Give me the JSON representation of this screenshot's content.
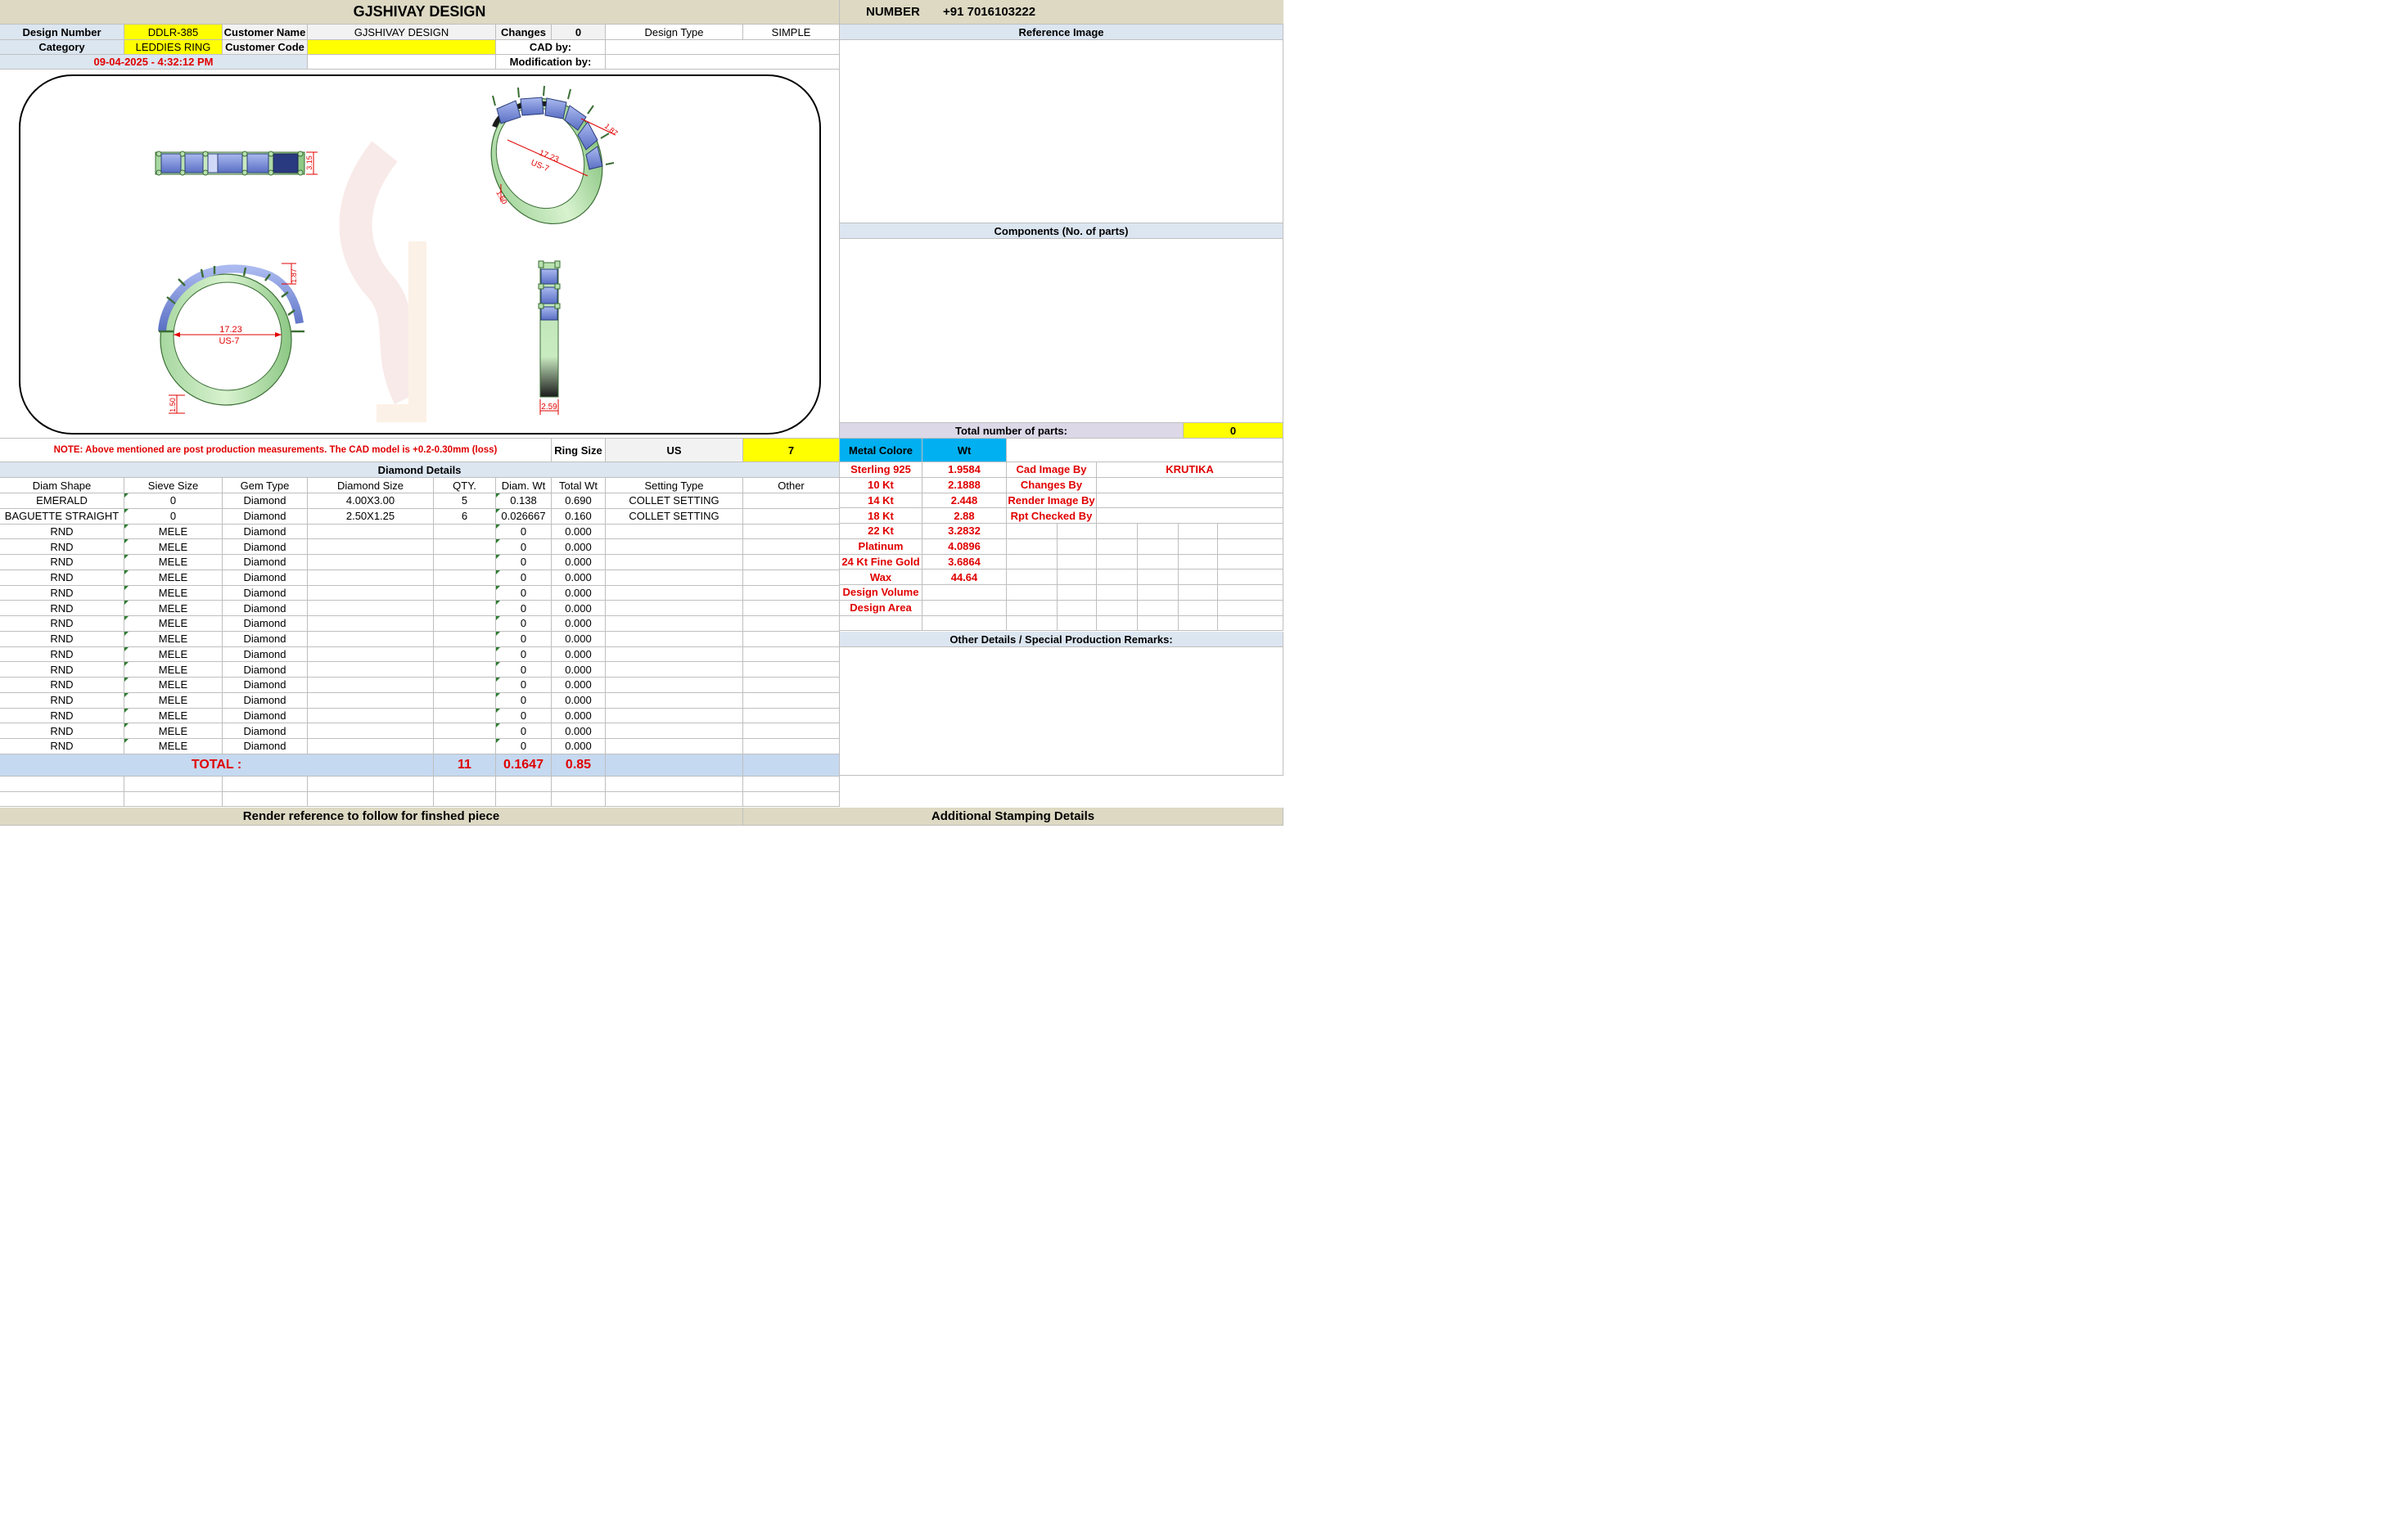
{
  "header": {
    "company": "GJSHIVAY DESIGN",
    "number_label": "NUMBER",
    "number_value": "+91 7016103222"
  },
  "info": {
    "design_number_label": "Design Number",
    "design_number": "DDLR-385",
    "customer_name_label": "Customer Name",
    "customer_name": "GJSHIVAY DESIGN",
    "changes_label": "Changes",
    "changes": "0",
    "design_type_label": "Design Type",
    "design_type": "SIMPLE",
    "category_label": "Category",
    "category": "LEDDIES RING",
    "customer_code_label": "Customer Code",
    "customer_code": "",
    "cad_by_label": "CAD by:",
    "cad_by": "",
    "datetime": "09-04-2025 - 4:32:12 PM",
    "modification_by_label": "Modification by:",
    "modification_by": ""
  },
  "drawing": {
    "top_view_height": "3.15",
    "iso_diameter": "17.23",
    "iso_size": "US-7",
    "iso_dim_a": "1.87",
    "iso_dim_b": "1.50",
    "front_diameter": "17.23",
    "front_size": "US-7",
    "front_dim_top": "1.87",
    "front_dim_bottom": "1.50",
    "side_dim": "2.59"
  },
  "right_panel": {
    "reference_image_label": "Reference Image",
    "components_label": "Components (No. of parts)",
    "total_parts_label": "Total number of parts:",
    "total_parts": "0"
  },
  "note": "NOTE: Above mentioned are post production measurements. The CAD model is +0.2-0.30mm (loss)",
  "ring_size": {
    "label": "Ring Size",
    "system": "US",
    "value": "7"
  },
  "metal": {
    "colore_label": "Metal Colore",
    "wt_label": "Wt",
    "rows": [
      {
        "name": "Sterling 925",
        "wt": "1.9584"
      },
      {
        "name": "10 Kt",
        "wt": "2.1888"
      },
      {
        "name": "14 Kt",
        "wt": "2.448"
      },
      {
        "name": "18 Kt",
        "wt": "2.88"
      },
      {
        "name": "22 Kt",
        "wt": "3.2832"
      },
      {
        "name": "Platinum",
        "wt": "4.0896"
      },
      {
        "name": "24 Kt Fine Gold",
        "wt": "3.6864"
      },
      {
        "name": "Wax",
        "wt": "44.64"
      },
      {
        "name": "Design Volume",
        "wt": ""
      },
      {
        "name": "Design Area",
        "wt": ""
      }
    ],
    "colors": {
      "accent_red": "#e00000",
      "metal_header": "#00b0f0",
      "highlight": "#ffff00"
    }
  },
  "credits": [
    {
      "label": "Cad Image By",
      "value": "KRUTIKA"
    },
    {
      "label": "Changes By",
      "value": ""
    },
    {
      "label": "Render Image By",
      "value": ""
    },
    {
      "label": "Rpt Checked By",
      "value": ""
    }
  ],
  "diamond": {
    "title": "Diamond Details",
    "headers": [
      "Diam Shape",
      "Sieve Size",
      "Gem Type",
      "Diamond Size",
      "QTY.",
      "Diam. Wt",
      "Total Wt",
      "Setting Type",
      "Other"
    ],
    "rows": [
      [
        "EMERALD",
        "0",
        "Diamond",
        "4.00X3.00",
        "5",
        "0.138",
        "0.690",
        "COLLET SETTING",
        ""
      ],
      [
        "BAGUETTE STRAIGHT",
        "0",
        "Diamond",
        "2.50X1.25",
        "6",
        "0.026667",
        "0.160",
        "COLLET SETTING",
        ""
      ],
      [
        "RND",
        "MELE",
        "Diamond",
        "",
        "",
        "0",
        "0.000",
        "",
        ""
      ],
      [
        "RND",
        "MELE",
        "Diamond",
        "",
        "",
        "0",
        "0.000",
        "",
        ""
      ],
      [
        "RND",
        "MELE",
        "Diamond",
        "",
        "",
        "0",
        "0.000",
        "",
        ""
      ],
      [
        "RND",
        "MELE",
        "Diamond",
        "",
        "",
        "0",
        "0.000",
        "",
        ""
      ],
      [
        "RND",
        "MELE",
        "Diamond",
        "",
        "",
        "0",
        "0.000",
        "",
        ""
      ],
      [
        "RND",
        "MELE",
        "Diamond",
        "",
        "",
        "0",
        "0.000",
        "",
        ""
      ],
      [
        "RND",
        "MELE",
        "Diamond",
        "",
        "",
        "0",
        "0.000",
        "",
        ""
      ],
      [
        "RND",
        "MELE",
        "Diamond",
        "",
        "",
        "0",
        "0.000",
        "",
        ""
      ],
      [
        "RND",
        "MELE",
        "Diamond",
        "",
        "",
        "0",
        "0.000",
        "",
        ""
      ],
      [
        "RND",
        "MELE",
        "Diamond",
        "",
        "",
        "0",
        "0.000",
        "",
        ""
      ],
      [
        "RND",
        "MELE",
        "Diamond",
        "",
        "",
        "0",
        "0.000",
        "",
        ""
      ],
      [
        "RND",
        "MELE",
        "Diamond",
        "",
        "",
        "0",
        "0.000",
        "",
        ""
      ],
      [
        "RND",
        "MELE",
        "Diamond",
        "",
        "",
        "0",
        "0.000",
        "",
        ""
      ],
      [
        "RND",
        "MELE",
        "Diamond",
        "",
        "",
        "0",
        "0.000",
        "",
        ""
      ],
      [
        "RND",
        "MELE",
        "Diamond",
        "",
        "",
        "0",
        "0.000",
        "",
        ""
      ]
    ],
    "total_label": "TOTAL :",
    "total_qty": "11",
    "total_diam_wt": "0.1647",
    "total_wt": "0.85"
  },
  "other_details_label": "Other Details / Special Production Remarks:",
  "footer": {
    "render_reference": "Render reference to follow for finshed piece",
    "stamping": "Additional Stamping Details"
  }
}
